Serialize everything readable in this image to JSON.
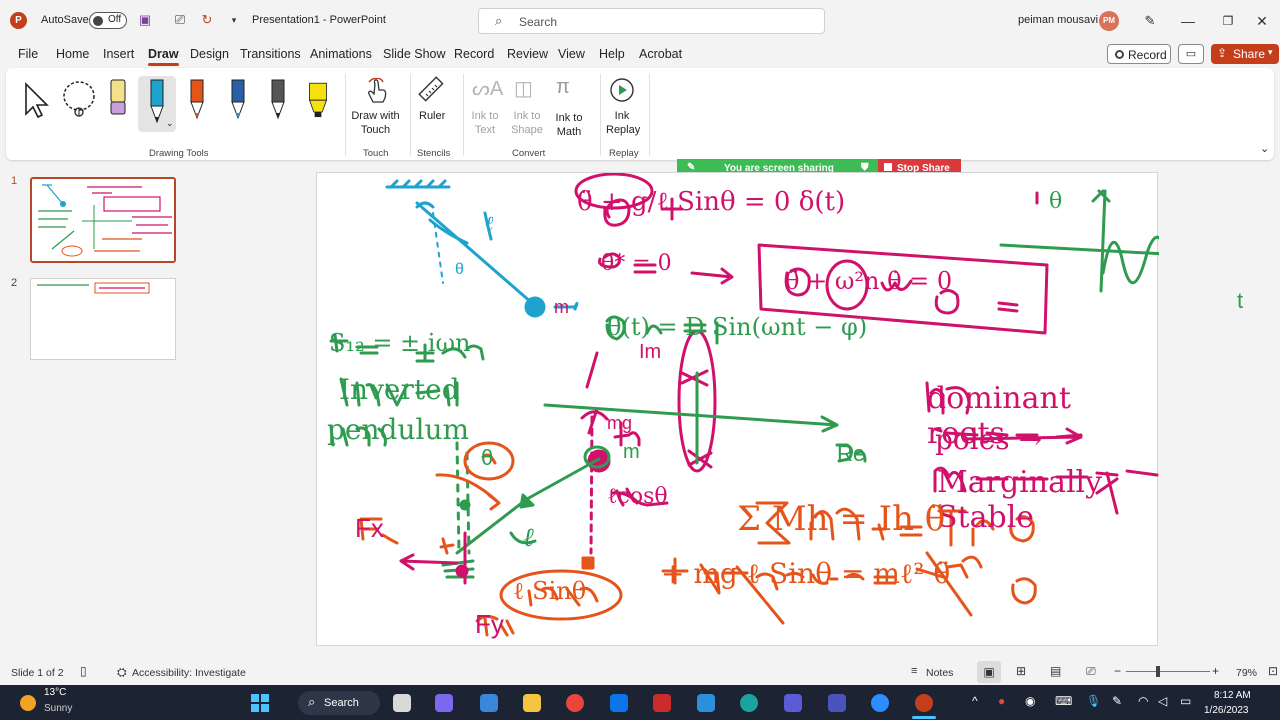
{
  "titlebar": {
    "autosave_label": "AutoSave",
    "autosave_state": "Off",
    "document_title": "Presentation1  -  PowerPoint",
    "search_placeholder": "Search",
    "user_name": "peiman mousavi",
    "user_initials": "PM"
  },
  "menu": {
    "tabs": [
      "File",
      "Home",
      "Insert",
      "Draw",
      "Design",
      "Transitions",
      "Animations",
      "Slide Show",
      "Record",
      "Review",
      "View",
      "Help",
      "Acrobat"
    ],
    "active": "Draw",
    "record_label": "Record",
    "share_label": "Share"
  },
  "ribbon": {
    "groups": {
      "drawing_tools": "Drawing Tools",
      "touch": "Touch",
      "stencils": "Stencils",
      "convert": "Convert",
      "replay": "Replay"
    },
    "buttons": {
      "draw_with_touch": "Draw with Touch",
      "ruler": "Ruler",
      "ink_to_text": "Ink to Text",
      "ink_to_shape": "Ink to Shape",
      "ink_to_math": "Ink to Math",
      "ink_replay": "Ink Replay"
    },
    "pen_colors": [
      "#f5e08a",
      "#1ea3cf",
      "#e5541b",
      "#2b5fa5",
      "#333333",
      "#f5e10f"
    ]
  },
  "slides": {
    "numbers": [
      "1",
      "2"
    ],
    "selected": 1
  },
  "sharing_bar": {
    "status": "You are screen sharing",
    "stop_label": "Stop Share"
  },
  "slide": {
    "ink": {
      "eq1": "θ̈ + g/ℓ Sinθ = 0 δ(t)",
      "theta_var": "θ",
      "pendulum_l": "ℓ",
      "pendulum_m": "m",
      "pendulum_theta": "θ",
      "eq2_left": "θ* = 0",
      "eq2_box": "θ̈ + ω²n θ̇ = 0",
      "s12": "S₁₂ = ± iωn",
      "theta_t": "θ(t) = D Sin(ωnt − φ)",
      "im": "Im",
      "re": "Re",
      "inverted": "Inverted",
      "pendulum_word": "pendulum",
      "dominant": "dominant roots",
      "poles": "poles →",
      "marginal": "Marginally Stable",
      "mg": "mg",
      "m2": "m",
      "theta_circle": "θ",
      "lcos": "ℓcosθ",
      "sum": "Σ Mh = Ih θ̈",
      "mgl": "+ mg ℓ Sinθ = mℓ² θ̈",
      "fx": "Fx",
      "fy": "Fy",
      "l2": "ℓ",
      "lsin": "ℓ Sinθ",
      "t_axis": "t"
    }
  },
  "statusbar": {
    "slide_info": "Slide 1 of 2",
    "accessibility": "Accessibility: Investigate",
    "notes": "Notes",
    "zoom": "79%"
  },
  "taskbar": {
    "temp": "13°C",
    "weather": "Sunny",
    "search_label": "Search",
    "time": "8:12 AM",
    "date": "1/26/2023"
  }
}
